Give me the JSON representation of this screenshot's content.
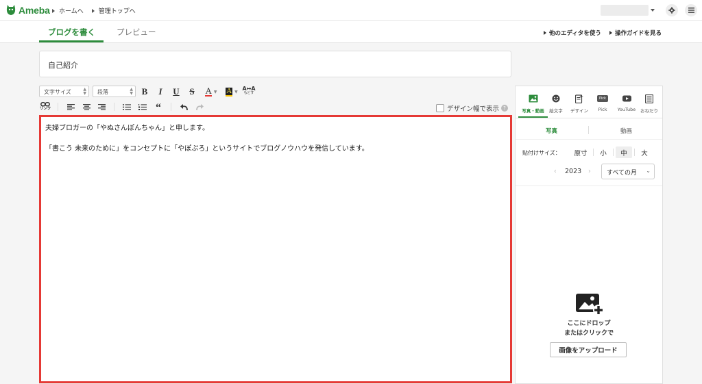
{
  "header": {
    "logo_text": "Ameba",
    "breadcrumbs": [
      "ホームへ",
      "管理トップへ"
    ]
  },
  "tabs": {
    "write": "ブログを書く",
    "preview": "プレビュー"
  },
  "links": {
    "other_editor": "他のエディタを使う",
    "guide": "操作ガイドを見る"
  },
  "title_value": "自己紹介",
  "toolbar": {
    "font_size": "文字サイズ",
    "paragraph": "段落",
    "bold": "B",
    "italic": "I",
    "underline": "U",
    "strike": "S",
    "text_color": "A",
    "bg_color": "A",
    "reset_top": "A",
    "reset_bottom": "もどす",
    "link_label": "リンク",
    "quote": "“",
    "design_width": "デザイン幅で表示",
    "help": "?"
  },
  "editor": {
    "line1": "夫婦ブロガーの「やぬさんぽんちゃん」と申します。",
    "line2": "「書こう 未来のために」をコンセプトに「やぽぷろ」というサイトでブログノウハウを発信しています。"
  },
  "panel": {
    "tabs": [
      "写真・動画",
      "絵文字",
      "デザイン",
      "Pick",
      "YouTube",
      "おねだり"
    ],
    "pick_badge": "Pick",
    "subtabs": [
      "写真",
      "動画"
    ],
    "size_label": "貼付けサイズ：",
    "sizes": [
      "原寸",
      "小",
      "中",
      "大"
    ],
    "selected_size": "中",
    "year": "2023",
    "month_select": "すべての月",
    "drop_line1": "ここにドロップ",
    "drop_line2": "またはクリックで",
    "upload_button": "画像をアップロード"
  },
  "colors": {
    "brand_green": "#2d8c3c",
    "editor_border": "#e53935"
  }
}
